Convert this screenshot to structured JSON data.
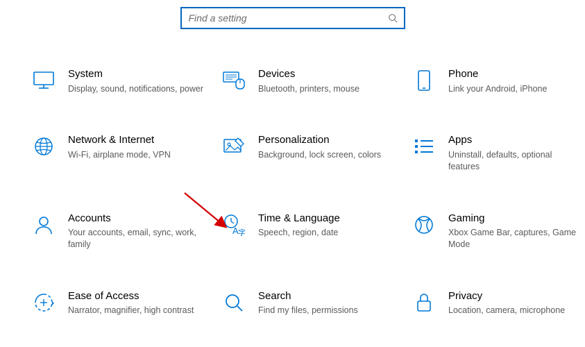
{
  "search": {
    "placeholder": "Find a setting"
  },
  "tiles": [
    {
      "title": "System",
      "desc": "Display, sound, notifications, power"
    },
    {
      "title": "Devices",
      "desc": "Bluetooth, printers, mouse"
    },
    {
      "title": "Phone",
      "desc": "Link your Android, iPhone"
    },
    {
      "title": "Network & Internet",
      "desc": "Wi-Fi, airplane mode, VPN"
    },
    {
      "title": "Personalization",
      "desc": "Background, lock screen, colors"
    },
    {
      "title": "Apps",
      "desc": "Uninstall, defaults, optional features"
    },
    {
      "title": "Accounts",
      "desc": "Your accounts, email, sync, work, family"
    },
    {
      "title": "Time & Language",
      "desc": "Speech, region, date"
    },
    {
      "title": "Gaming",
      "desc": "Xbox Game Bar, captures, Game Mode"
    },
    {
      "title": "Ease of Access",
      "desc": "Narrator, magnifier, high contrast"
    },
    {
      "title": "Search",
      "desc": "Find my files, permissions"
    },
    {
      "title": "Privacy",
      "desc": "Location, camera, microphone"
    }
  ],
  "colors": {
    "accent": "#0078d7",
    "arrow": "#d40000"
  }
}
